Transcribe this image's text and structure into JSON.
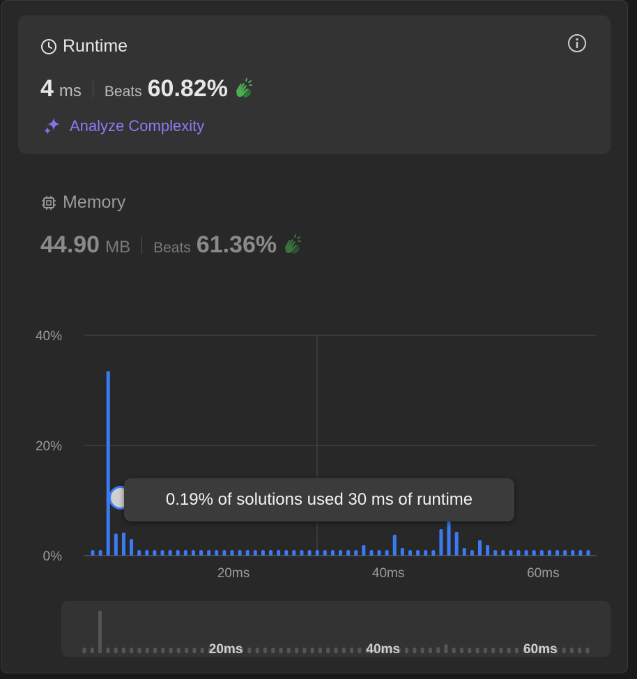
{
  "runtime": {
    "title": "Runtime",
    "value": "4",
    "unit": "ms",
    "beats_label": "Beats",
    "beats_value": "60.82%",
    "analyze_label": "Analyze Complexity"
  },
  "memory": {
    "title": "Memory",
    "value": "44.90",
    "unit": "MB",
    "beats_label": "Beats",
    "beats_value": "61.36%"
  },
  "tooltip": {
    "text": "0.19% of solutions used 30 ms of runtime"
  },
  "colors": {
    "bar": "#3a7bf5",
    "accent_purple": "#8b7bf2",
    "clap": "#4caf50"
  },
  "icons": {
    "runtime": "clock-icon",
    "info": "info-icon",
    "analyze": "sparkle-icon",
    "memory": "chip-icon",
    "clap": "clapping-hands-icon"
  },
  "chart_data": {
    "type": "bar",
    "x_unit": "ms",
    "x": [
      2,
      3,
      4,
      5,
      6,
      7,
      8,
      9,
      10,
      11,
      12,
      13,
      14,
      15,
      16,
      17,
      18,
      19,
      20,
      21,
      22,
      23,
      24,
      25,
      26,
      27,
      28,
      29,
      30,
      31,
      32,
      33,
      34,
      35,
      36,
      37,
      38,
      39,
      40,
      41,
      42,
      43,
      44,
      45,
      46,
      47,
      48,
      49,
      50,
      51,
      52,
      53,
      54,
      55,
      56,
      57,
      58,
      59,
      60,
      61,
      62,
      63,
      64,
      65,
      66
    ],
    "values": [
      1,
      1,
      33.5,
      4,
      4.2,
      3,
      1,
      1,
      1,
      1,
      1,
      1,
      1,
      1,
      1,
      1,
      1,
      1,
      1,
      1,
      1,
      1,
      1,
      1,
      1,
      1,
      1,
      1,
      1,
      1,
      1,
      1,
      1,
      1,
      1,
      1.9,
      1,
      1,
      1,
      3.8,
      1.4,
      1,
      1,
      1,
      1,
      4.8,
      7,
      4.3,
      1.4,
      1,
      2.8,
      1.9,
      1,
      1,
      1,
      1,
      1,
      1,
      1,
      1,
      1,
      1,
      1,
      1,
      1
    ],
    "y_ticks": [
      "40%",
      "20%",
      "0%"
    ],
    "y_tick_values": [
      40,
      20,
      0
    ],
    "x_ticks": [
      "20ms",
      "40ms",
      "60ms"
    ],
    "x_tick_values": [
      20,
      40,
      60
    ],
    "ylim": [
      0,
      40
    ],
    "grid": true,
    "mini_x_ticks": [
      "20ms",
      "40ms",
      "60ms"
    ]
  }
}
